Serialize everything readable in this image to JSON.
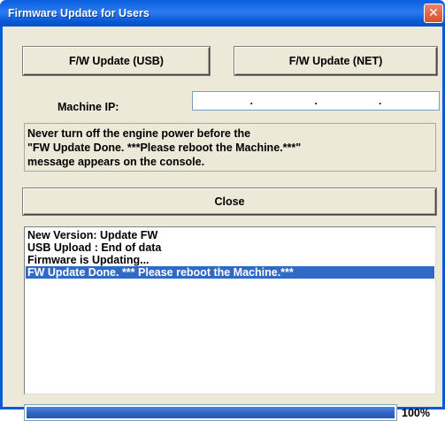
{
  "window": {
    "title": "Firmware Update for Users",
    "close_glyph": "✕"
  },
  "buttons": {
    "usb_label": "F/W Update (USB)",
    "net_label": "F/W Update (NET)",
    "close_label": "Close"
  },
  "machine_ip": {
    "label": "Machine IP:",
    "octets": [
      "",
      "",
      "",
      ""
    ],
    "separators": [
      ".",
      ".",
      "."
    ]
  },
  "warning": {
    "line1": "Never turn off the engine power before the",
    "line2": "\"FW Update Done. ***Please reboot the Machine.***\"",
    "line3": "message appears on the console."
  },
  "log": {
    "lines": [
      "New Version: Update FW",
      "USB Upload : End of data",
      "Firmware is Updating...",
      "FW Update Done. *** Please reboot the Machine.***"
    ],
    "selected_index": 3
  },
  "progress": {
    "value": 1.0,
    "label": "100%"
  },
  "colors": {
    "titlebar": "#0a59d8",
    "dialog_bg": "#ece9d8",
    "selection": "#316ac5",
    "progress_fill": "#2e65c4"
  }
}
